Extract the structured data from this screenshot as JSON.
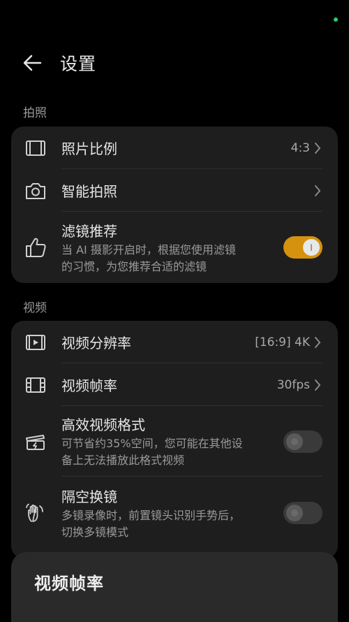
{
  "header": {
    "title": "设置"
  },
  "sections": {
    "photo": {
      "label": "拍照",
      "rows": [
        {
          "label": "照片比例",
          "value": "4:3"
        },
        {
          "label": "智能拍照"
        },
        {
          "label": "滤镜推荐",
          "desc_line1": "当 AI 摄影开启时，根据您使用滤镜",
          "desc_line2": "的习惯，为您推荐合适的滤镜",
          "toggle": "on"
        }
      ]
    },
    "video": {
      "label": "视频",
      "rows": [
        {
          "label": "视频分辨率",
          "value": "[16:9] 4K"
        },
        {
          "label": "视频帧率",
          "value": "30fps"
        },
        {
          "label": "高效视频格式",
          "desc_line1": "可节省约35%空间，您可能在其他设",
          "desc_line2": "备上无法播放此格式视频",
          "toggle": "off"
        },
        {
          "label": "隔空换镜",
          "desc_line1": "多镜录像时，前置镜头识别手势后，",
          "desc_line2": "切换多镜模式",
          "toggle": "off"
        }
      ]
    }
  },
  "sheet": {
    "title": "视频帧率"
  },
  "colors": {
    "accent": "#d4920f",
    "card": "#1e1e1e",
    "background": "#000000"
  }
}
